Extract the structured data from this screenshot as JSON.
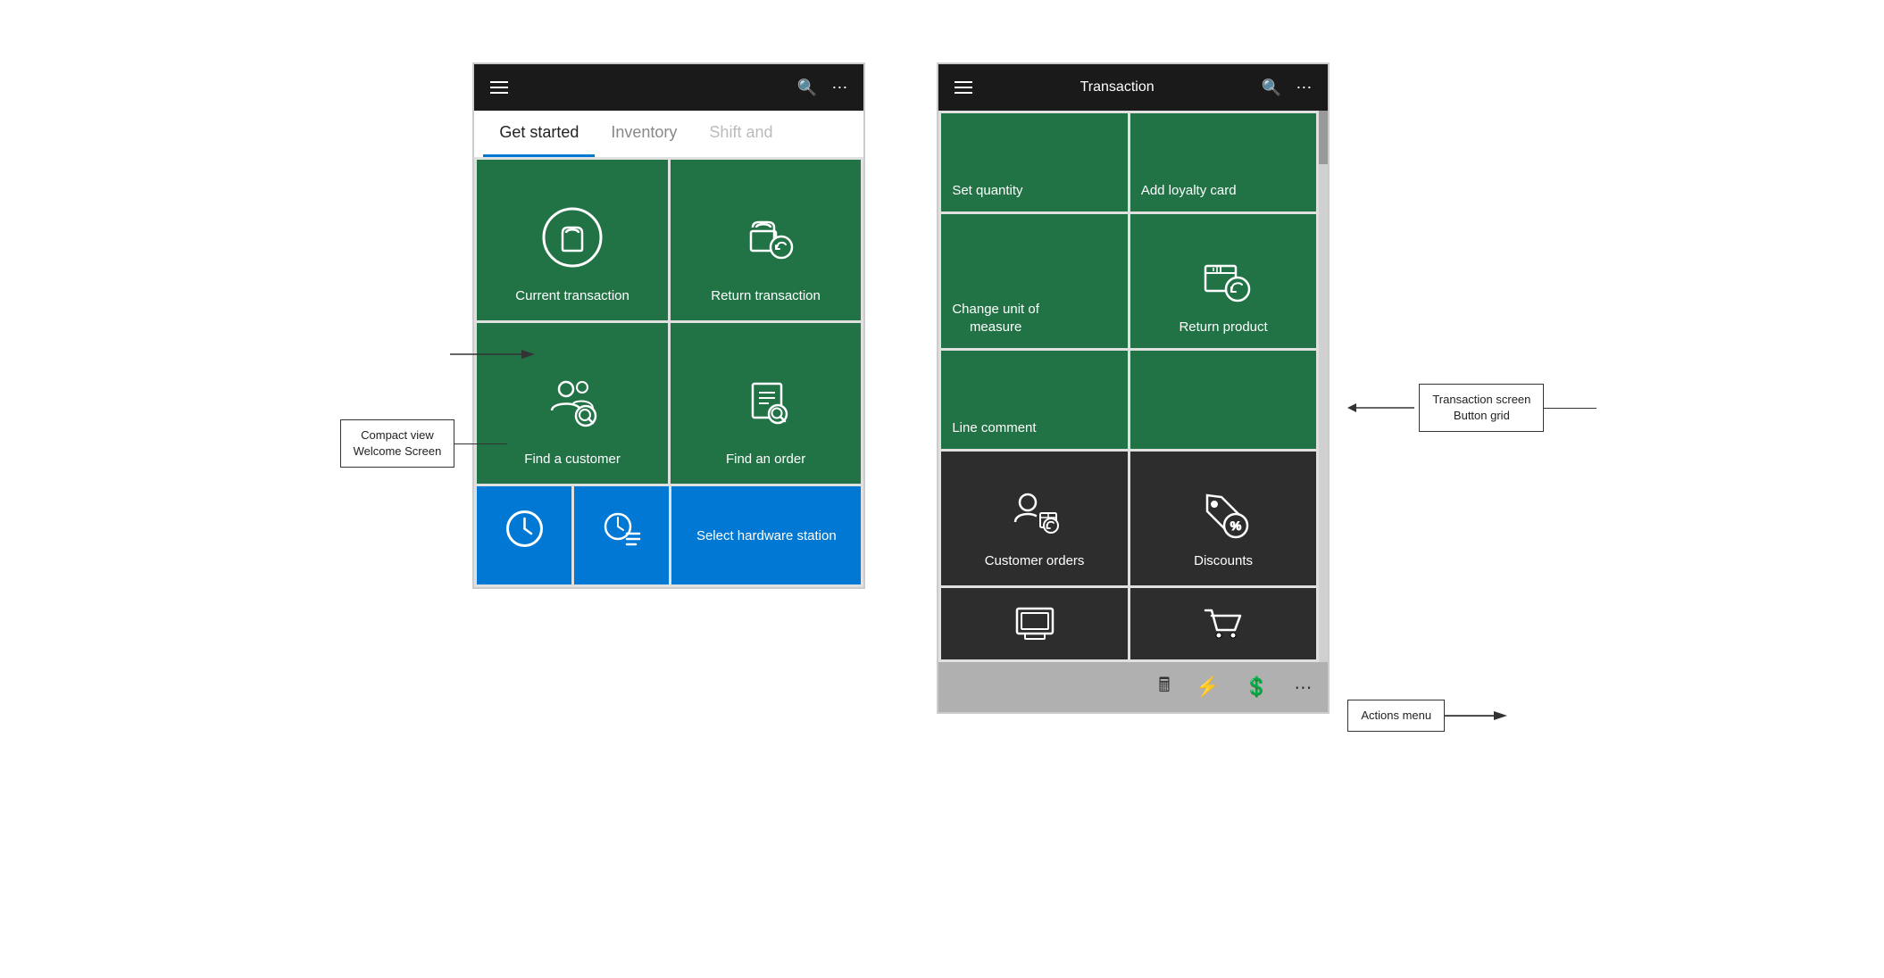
{
  "left_panel": {
    "label": "Compact view\nWelcome Screen",
    "header": {
      "title": "",
      "icons": [
        "hamburger",
        "search",
        "ellipsis"
      ]
    },
    "tabs": [
      {
        "label": "Get started",
        "active": true
      },
      {
        "label": "Inventory",
        "active": false
      },
      {
        "label": "Shift and",
        "active": false,
        "partial": true
      }
    ],
    "buttons": [
      {
        "label": "Current transaction",
        "color": "green",
        "icon": "bag"
      },
      {
        "label": "Return transaction",
        "color": "green",
        "icon": "bag-return"
      },
      {
        "label": "Find a customer",
        "color": "green",
        "icon": "find-customer"
      },
      {
        "label": "Find an order",
        "color": "green",
        "icon": "find-order"
      }
    ],
    "bottom_buttons": [
      {
        "label": "",
        "color": "blue",
        "icon": "clock"
      },
      {
        "label": "",
        "color": "blue",
        "icon": "clock-list"
      },
      {
        "label": "Select hardware station",
        "color": "blue",
        "icon": ""
      }
    ]
  },
  "right_panel": {
    "label": "Transaction screen\nButton grid",
    "actions_label": "Actions menu",
    "header": {
      "title": "Transaction",
      "icons": [
        "hamburger",
        "search",
        "ellipsis"
      ]
    },
    "buttons": [
      {
        "label": "Set quantity",
        "color": "green",
        "row": 1
      },
      {
        "label": "Add loyalty card",
        "color": "green",
        "row": 1
      },
      {
        "label": "Change unit of\nmeasure",
        "color": "green",
        "row": 2
      },
      {
        "label": "Return product",
        "color": "green",
        "icon": "box-return",
        "row": 2
      },
      {
        "label": "Line comment",
        "color": "green",
        "row": 3
      },
      {
        "label": "",
        "color": "green",
        "row": 3
      },
      {
        "label": "Customer orders",
        "color": "dark",
        "icon": "customer-orders",
        "row": 4
      },
      {
        "label": "Discounts",
        "color": "dark",
        "icon": "discounts",
        "row": 4
      }
    ],
    "partial_tiles": [
      {
        "label": "",
        "icon": "register"
      },
      {
        "label": "",
        "icon": "cart"
      }
    ],
    "action_bar": {
      "icons": [
        "calculator",
        "lightning",
        "dollar",
        "ellipsis"
      ]
    }
  }
}
